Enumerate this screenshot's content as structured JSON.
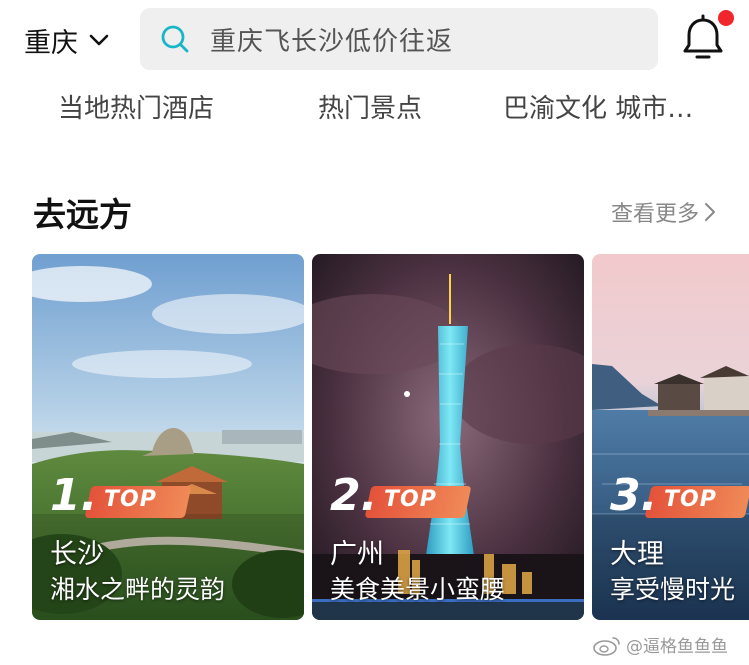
{
  "header": {
    "city": "重庆",
    "search_placeholder": "重庆飞长沙低价往返"
  },
  "tags": [
    "当地热门酒店",
    "热门景点",
    "巴渝文化 城市…"
  ],
  "section": {
    "title": "去远方",
    "more_label": "查看更多"
  },
  "cards": [
    {
      "rank": "1.",
      "rank_label": "TOP",
      "city": "长沙",
      "slogan": "湘水之畔的灵韵"
    },
    {
      "rank": "2.",
      "rank_label": "TOP",
      "city": "广州",
      "slogan": "美食美景小蛮腰"
    },
    {
      "rank": "3.",
      "rank_label": "TOP",
      "city": "大理",
      "slogan": "享受慢时光"
    }
  ],
  "watermark": "@逼格鱼鱼鱼",
  "colors": {
    "accent_red": "#f0262c",
    "badge_orange": "#e4523a",
    "search_icon": "#19b5c8"
  }
}
